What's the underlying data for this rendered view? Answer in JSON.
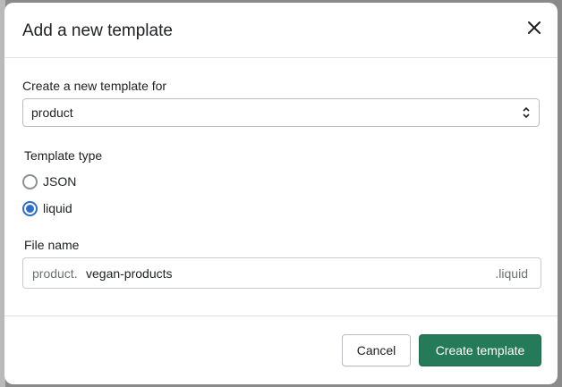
{
  "modal": {
    "title": "Add a new template",
    "close_icon": "close-icon"
  },
  "template_for": {
    "label": "Create a new template for",
    "selected": "product",
    "arrow_icon": "select-arrows-icon"
  },
  "template_type": {
    "label": "Template type",
    "options": [
      {
        "label": "JSON",
        "checked": false
      },
      {
        "label": "liquid",
        "checked": true
      }
    ]
  },
  "file_name": {
    "label": "File name",
    "prefix": "product.",
    "value": "vegan-products",
    "suffix": ".liquid"
  },
  "footer": {
    "cancel_label": "Cancel",
    "create_label": "Create template"
  },
  "colors": {
    "accent_radio": "#2c6ecb",
    "primary_button": "#257a5a"
  }
}
